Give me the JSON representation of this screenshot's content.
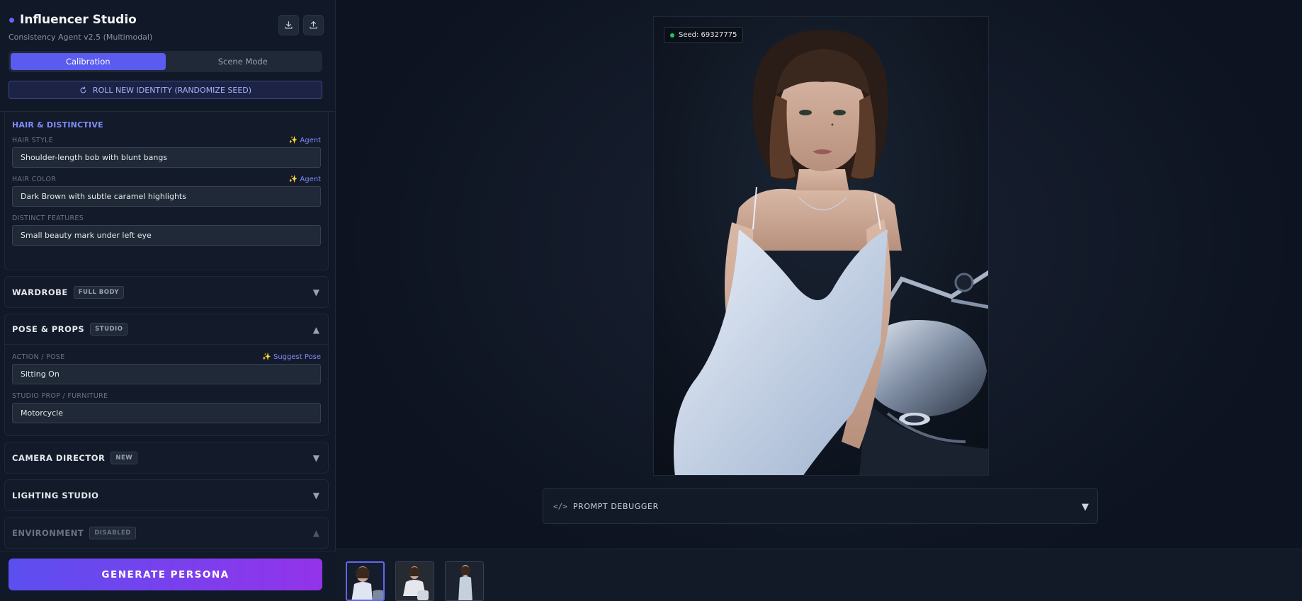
{
  "app": {
    "title": "Influencer Studio",
    "subtitle": "Consistency Agent v2.5 (Multimodal)"
  },
  "header_buttons": {
    "download_icon": "download-icon",
    "upload_icon": "upload-icon"
  },
  "modes": {
    "calibration": "Calibration",
    "scene": "Scene Mode",
    "active": "Calibration"
  },
  "roll_button": "ROLL NEW IDENTITY (RANDOMIZE SEED)",
  "hair": {
    "section_title": "HAIR & DISTINCTIVE",
    "hair_style_label": "HAIR STYLE",
    "hair_style_value": "Shoulder-length bob with blunt bangs",
    "hair_style_agent": "✨ Agent",
    "hair_color_label": "HAIR COLOR",
    "hair_color_value": "Dark Brown with subtle caramel highlights",
    "hair_color_agent": "✨ Agent",
    "distinct_label": "DISTINCT FEATURES",
    "distinct_value": "Small beauty mark under left eye"
  },
  "wardrobe": {
    "title": "WARDROBE",
    "badge": "FULL BODY",
    "caret": "▼"
  },
  "pose": {
    "title": "POSE & PROPS",
    "badge": "STUDIO",
    "caret": "▲",
    "action_label": "ACTION / POSE",
    "suggest": "✨ Suggest Pose",
    "action_value": "Sitting On",
    "prop_label": "STUDIO PROP / FURNITURE",
    "prop_value": "Motorcycle"
  },
  "camera": {
    "title": "CAMERA DIRECTOR",
    "badge": "NEW",
    "caret": "▼"
  },
  "lighting": {
    "title": "LIGHTING STUDIO",
    "caret": "▼"
  },
  "environment": {
    "title": "ENVIRONMENT",
    "badge": "DISABLED",
    "caret": "▲"
  },
  "generate_button": "GENERATE PERSONA",
  "preview": {
    "seed_text": "Seed: 69327775",
    "debugger_label": "PROMPT DEBUGGER",
    "debugger_icon": "</>",
    "debugger_caret": "▼"
  },
  "thumbnails": {
    "count": 3,
    "active_index": 0
  },
  "colors": {
    "accent": "#5b5bf0",
    "gradient_start": "#5b4ff0",
    "gradient_end": "#9333ea",
    "status": "#22c55e"
  }
}
